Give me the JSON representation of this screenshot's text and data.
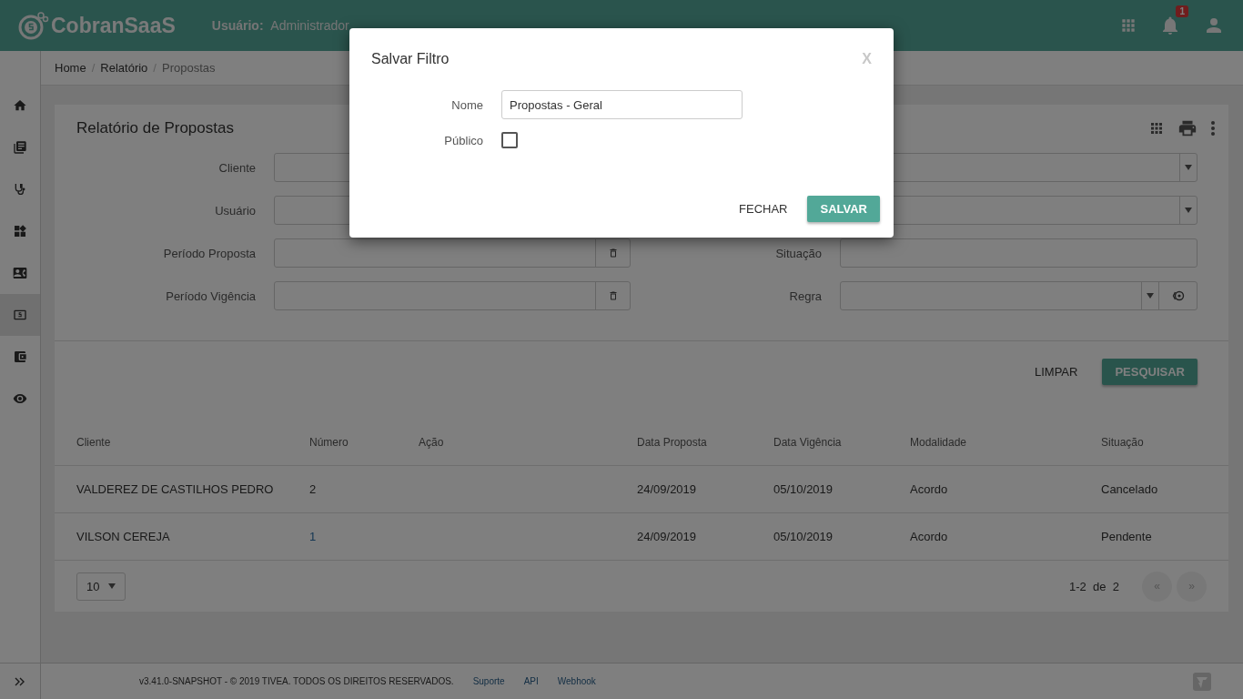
{
  "header": {
    "logo": "CobranSaaS",
    "user_label": "Usuário:",
    "user": "Administrador",
    "notifications": "1"
  },
  "sidebar": {
    "items": [
      {
        "selected": false
      },
      {
        "selected": false
      },
      {
        "selected": false
      },
      {
        "selected": false
      },
      {
        "selected": false
      },
      {
        "selected": true
      },
      {
        "selected": false
      },
      {
        "selected": false
      }
    ]
  },
  "breadcrumb": [
    {
      "label": "Home",
      "current": false
    },
    {
      "separator": "/",
      "label": "Relatório",
      "current": false
    },
    {
      "separator": "/",
      "label": "Propostas",
      "current": true
    }
  ],
  "report": {
    "title": "Relatório de Propostas",
    "fields": [
      {
        "label": "Cliente",
        "kind": "text"
      },
      {
        "kind": "select"
      },
      {
        "label": "Usuário",
        "kind": "text"
      },
      {
        "kind": "select"
      },
      {
        "label": "Período Proposta",
        "kind": "date"
      },
      {
        "label": "Situação",
        "kind": "text"
      },
      {
        "label": "Período Vigência",
        "kind": "date"
      },
      {
        "label": "Regra",
        "kind": "rule"
      }
    ],
    "buttons": [
      {
        "label": "LIMPAR",
        "kind": "flat"
      },
      {
        "label": "PESQUISAR",
        "kind": "raised"
      }
    ]
  },
  "table": {
    "columns": [
      "Cliente",
      "Número",
      "Ação",
      "Data Proposta",
      "Data Vigência",
      "Modalidade",
      "Situação"
    ],
    "rows": [
      {
        "cells": [
          "VALDEREZ DE CASTILHOS PEDRO",
          "2",
          "",
          "24/09/2019",
          "05/10/2019",
          "Acordo",
          "Cancelado"
        ],
        "linked": false
      },
      {
        "cells": [
          "VILSON CEREJA",
          "1",
          "",
          "24/09/2019",
          "05/10/2019",
          "Acordo",
          "Pendente"
        ],
        "linked": true
      }
    ]
  },
  "pagination": {
    "page_size": "10",
    "range": "1-2  de  2",
    "prev": "«",
    "next": "»",
    "disabled": true
  },
  "footer": {
    "copyright": "v3.41.0-SNAPSHOT - © 2019 TIVEA. TODOS OS DIREITOS RESERVADOS.",
    "links": [
      "Suporte",
      "API",
      "Webhook"
    ]
  },
  "modal": {
    "title": "Salvar Filtro",
    "close": "X",
    "name_label": "Nome",
    "name_value": "Propostas - Geral",
    "public_label": "Público",
    "public_checked": false,
    "buttons": [
      {
        "label": "FECHAR",
        "kind": "flat"
      },
      {
        "label": "SALVAR",
        "kind": "raised"
      }
    ]
  }
}
